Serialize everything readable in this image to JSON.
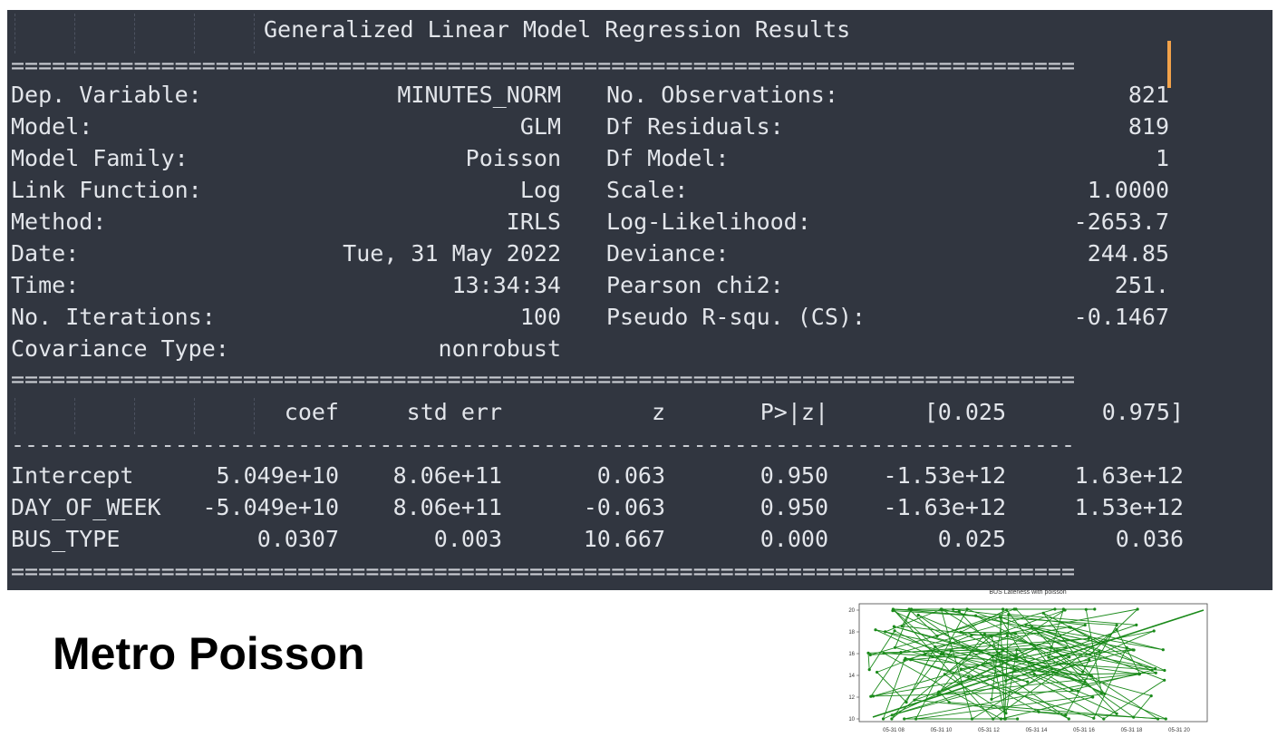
{
  "terminal": {
    "title": "Generalized Linear Model Regression Results",
    "rule_double": "==============================================================================",
    "rule_single": "------------------------------------------------------------------------------",
    "summary_rows": [
      {
        "label": "Dep. Variable:",
        "value": "MINUTES_NORM",
        "label2": "No. Observations:",
        "value2": "821"
      },
      {
        "label": "Model:",
        "value": "GLM",
        "label2": "Df Residuals:",
        "value2": "819"
      },
      {
        "label": "Model Family:",
        "value": "Poisson",
        "label2": "Df Model:",
        "value2": "1"
      },
      {
        "label": "Link Function:",
        "value": "Log",
        "label2": "Scale:",
        "value2": "1.0000"
      },
      {
        "label": "Method:",
        "value": "IRLS",
        "label2": "Log-Likelihood:",
        "value2": "-2653.7"
      },
      {
        "label": "Date:",
        "value": "Tue, 31 May 2022",
        "label2": "Deviance:",
        "value2": "244.85"
      },
      {
        "label": "Time:",
        "value": "13:34:34",
        "label2": "Pearson chi2:",
        "value2": "251."
      },
      {
        "label": "No. Iterations:",
        "value": "100",
        "label2": "Pseudo R-squ. (CS):",
        "value2": "-0.1467"
      },
      {
        "label": "Covariance Type:",
        "value": "nonrobust",
        "label2": "",
        "value2": ""
      }
    ],
    "coef_headers": [
      "coef",
      "std err",
      "z",
      "P>|z|",
      "[0.025",
      "0.975]"
    ],
    "coef_rows": [
      {
        "name": "Intercept",
        "cells": [
          "5.049e+10",
          "8.06e+11",
          "0.063",
          "0.950",
          "-1.53e+12",
          "1.63e+12"
        ]
      },
      {
        "name": "DAY_OF_WEEK",
        "cells": [
          "-5.049e+10",
          "8.06e+11",
          "-0.063",
          "0.950",
          "-1.63e+12",
          "1.53e+12"
        ]
      },
      {
        "name": "BUS_TYPE",
        "cells": [
          "0.0307",
          "0.003",
          "10.667",
          "0.000",
          "0.025",
          "0.036"
        ]
      }
    ]
  },
  "caption": "Metro Poisson",
  "thumbnail": {
    "title": "BUS Lateness with poisson",
    "y_ticks": [
      "20",
      "18",
      "16",
      "14",
      "12",
      "10"
    ],
    "x_ticks": [
      "05-31 08",
      "05-31 10",
      "05-31 12",
      "05-31 14",
      "05-31 16",
      "05-31 18",
      "05-31 20"
    ],
    "line_color": "#1a8a1a"
  }
}
